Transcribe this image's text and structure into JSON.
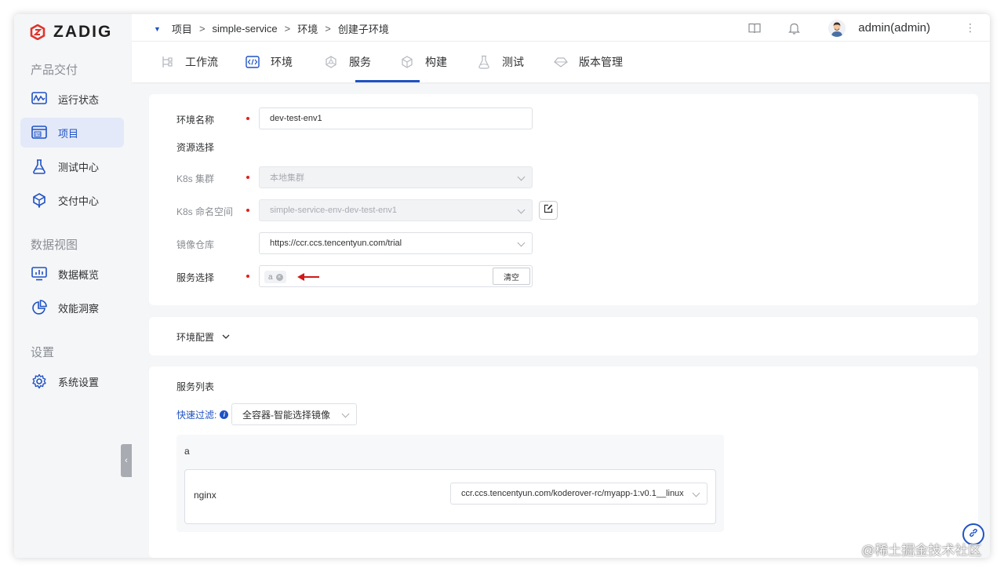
{
  "brand": {
    "name": "ZADIG",
    "color": "#e0342b",
    "accent": "#1f52c4"
  },
  "sidebar": {
    "sections": [
      {
        "title": "产品交付",
        "items": [
          {
            "label": "运行状态",
            "icon": "monitor-wave-icon"
          },
          {
            "label": "项目",
            "icon": "pm-board-icon",
            "active": true
          },
          {
            "label": "测试中心",
            "icon": "flask-icon"
          },
          {
            "label": "交付中心",
            "icon": "package-icon"
          }
        ]
      },
      {
        "title": "数据视图",
        "items": [
          {
            "label": "数据概览",
            "icon": "dashboard-icon"
          },
          {
            "label": "效能洞察",
            "icon": "pie-chart-icon"
          }
        ]
      },
      {
        "title": "设置",
        "items": [
          {
            "label": "系统设置",
            "icon": "gear-icon"
          }
        ]
      }
    ]
  },
  "breadcrumb": [
    "项目",
    "simple-service",
    "环境",
    "创建子环境"
  ],
  "user": {
    "name": "admin(admin)"
  },
  "tabs": [
    {
      "label": "工作流",
      "icon": "workflow-icon"
    },
    {
      "label": "环境",
      "icon": "code-icon",
      "active": true
    },
    {
      "label": "服务",
      "icon": "cube-network-icon"
    },
    {
      "label": "构建",
      "icon": "cube-icon"
    },
    {
      "label": "测试",
      "icon": "flask-icon"
    },
    {
      "label": "版本管理",
      "icon": "diamond-icon"
    }
  ],
  "form": {
    "env_name": {
      "label": "环境名称",
      "value": "dev-test-env1"
    },
    "resource_section": "资源选择",
    "cluster": {
      "label": "K8s 集群",
      "value": "本地集群"
    },
    "namespace": {
      "label": "K8s 命名空间",
      "value": "simple-service-env-dev-test-env1"
    },
    "registry": {
      "label": "镜像仓库",
      "value": "https://ccr.ccs.tencentyun.com/trial"
    },
    "services": {
      "label": "服务选择",
      "tag": "a",
      "clear_label": "清空"
    }
  },
  "env_config": {
    "label": "环境配置"
  },
  "service_list": {
    "title": "服务列表",
    "filter_label": "快速过滤:",
    "filter_value": "全容器-智能选择镜像",
    "group": {
      "name": "a",
      "rows": [
        {
          "service": "nginx",
          "image": "ccr.ccs.tencentyun.com/koderover-rc/myapp-1:v0.1__linux"
        }
      ]
    }
  },
  "watermark": "@稀土掘金技术社区"
}
